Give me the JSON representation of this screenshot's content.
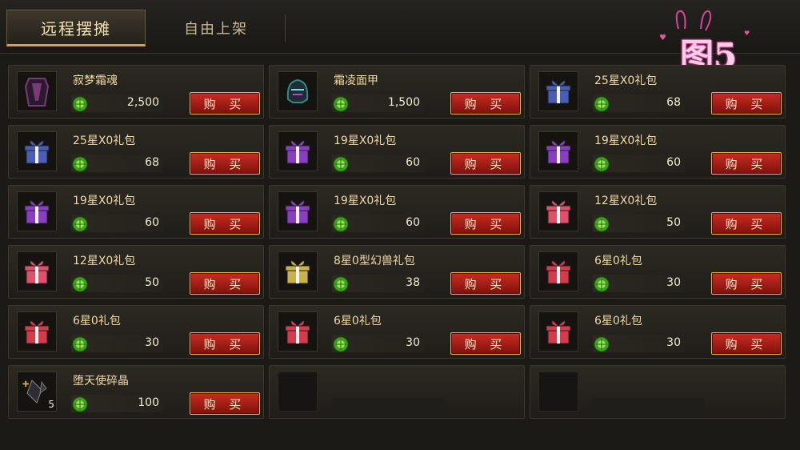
{
  "tabs": {
    "active": "远程摆摊",
    "inactive": "自由上架"
  },
  "decoration": {
    "text": "图5"
  },
  "buy_label": "购 买",
  "items": [
    {
      "name": "寂梦霜魂",
      "price": "2,500",
      "icon": "armor-icon",
      "color": "#7a3a7a"
    },
    {
      "name": "霜凌面甲",
      "price": "1,500",
      "icon": "helmet-icon",
      "color": "#2e8a8a"
    },
    {
      "name": "25星X0礼包",
      "price": "68",
      "icon": "gift-icon",
      "color": "#4a5db8"
    },
    {
      "name": "25星X0礼包",
      "price": "68",
      "icon": "gift-icon",
      "color": "#4a5db8"
    },
    {
      "name": "19星X0礼包",
      "price": "60",
      "icon": "gift-icon",
      "color": "#8a3ec4"
    },
    {
      "name": "19星X0礼包",
      "price": "60",
      "icon": "gift-icon",
      "color": "#8a3ec4"
    },
    {
      "name": "19星X0礼包",
      "price": "60",
      "icon": "gift-icon",
      "color": "#8a3ec4"
    },
    {
      "name": "19星X0礼包",
      "price": "60",
      "icon": "gift-icon",
      "color": "#8a3ec4"
    },
    {
      "name": "12星X0礼包",
      "price": "50",
      "icon": "gift-icon",
      "color": "#e0506a"
    },
    {
      "name": "12星X0礼包",
      "price": "50",
      "icon": "gift-icon",
      "color": "#e0506a"
    },
    {
      "name": "8星0型幻兽礼包",
      "price": "38",
      "icon": "gift-icon",
      "color": "#c9b24a"
    },
    {
      "name": "6星0礼包",
      "price": "30",
      "icon": "gift-icon",
      "color": "#d53b4a"
    },
    {
      "name": "6星0礼包",
      "price": "30",
      "icon": "gift-icon",
      "color": "#d53b4a"
    },
    {
      "name": "6星0礼包",
      "price": "30",
      "icon": "gift-icon",
      "color": "#d53b4a"
    },
    {
      "name": "6星0礼包",
      "price": "30",
      "icon": "gift-icon",
      "color": "#d53b4a"
    },
    {
      "name": "堕天使碎晶",
      "price": "100",
      "icon": "crystal-icon",
      "color": "#c9a43a",
      "count": "5"
    }
  ]
}
